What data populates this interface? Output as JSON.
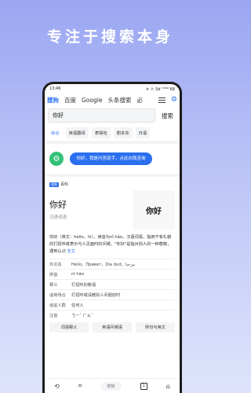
{
  "headline": "专注于搜索本身",
  "status": {
    "time": "13:46",
    "right": "✈ ⓝ Sd ᴴᵈ⁵ᴳ 68"
  },
  "tabs": [
    "搜狗",
    "百度",
    "Google",
    "头条搜索",
    "必"
  ],
  "search": {
    "query": "你好",
    "button": "搜索"
  },
  "chips": [
    "综合",
    "英语翻译",
    "表情包",
    "剧本杀",
    "日语"
  ],
  "assistant": {
    "message": "你好，我是问答助手，点此向我咨询"
  },
  "baike": {
    "logo": "搜狗",
    "name": "百科",
    "word": "你好",
    "subtitle": "汉语词语",
    "image_text": "你好",
    "description": "你好（英文：hello，hi），读音为nǐ hǎo，汉语词语，指用于有礼貌的打招呼或表示与人见面时的问候。\"你好\"是指对别人的一种尊敬，遇到认识",
    "more": "全文",
    "props": [
      {
        "k": "外文名",
        "v": "Hello，Привет，Dia duit，مرحبا"
      },
      {
        "k": "拼音",
        "v": "nǐ hǎo"
      },
      {
        "k": "释义",
        "v": "打招呼的敬语"
      },
      {
        "k": "适用场合",
        "v": "打招呼或请教别人问题前时"
      },
      {
        "k": "适宜人群",
        "v": "任何人"
      },
      {
        "k": "注音",
        "v": "ㄋㄧˇ ㄏㄠˇ"
      }
    ],
    "actions": [
      "词语释义",
      "英语问候语",
      "例句与英文"
    ]
  },
  "bottombar": {
    "back": "⟲",
    "grid": "⌗",
    "search_label": "你好",
    "tabs_count": "1",
    "home": "⌂"
  }
}
